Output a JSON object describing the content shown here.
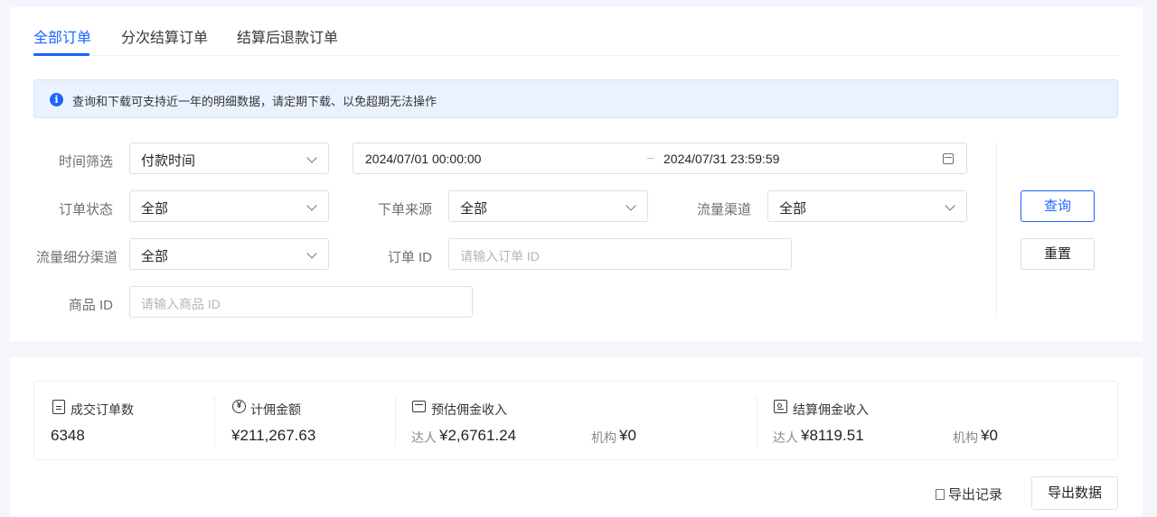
{
  "tabs": [
    {
      "label": "全部订单",
      "active": true
    },
    {
      "label": "分次结算订单",
      "active": false
    },
    {
      "label": "结算后退款订单",
      "active": false
    }
  ],
  "notice": {
    "icon": "info-icon",
    "text": "查询和下载可支持近一年的明细数据，请定期下载、以免超期无法操作"
  },
  "filters": {
    "time_filter": {
      "label": "时间筛选",
      "value": "付款时间"
    },
    "date_range": {
      "start": "2024/07/01 00:00:00",
      "separator": "–",
      "end": "2024/07/31 23:59:59"
    },
    "order_status": {
      "label": "订单状态",
      "value": "全部"
    },
    "order_source": {
      "label": "下单来源",
      "value": "全部"
    },
    "traffic_channel": {
      "label": "流量渠道",
      "value": "全部"
    },
    "traffic_sub_channel": {
      "label": "流量细分渠道",
      "value": "全部"
    },
    "order_id": {
      "label": "订单 ID",
      "placeholder": "请输入订单 ID"
    },
    "product_id": {
      "label": "商品 ID",
      "placeholder": "请输入商品 ID"
    }
  },
  "actions": {
    "query": "查询",
    "reset": "重置"
  },
  "stats": {
    "deal_orders": {
      "title": "成交订单数",
      "value": "6348"
    },
    "commission_amount": {
      "title": "计佣金额",
      "value": "¥211,267.63"
    },
    "estimated_income": {
      "title": "预估佣金收入",
      "talent_label": "达人",
      "talent_value": "¥2,6761.24",
      "agency_label": "机构",
      "agency_value": "¥0"
    },
    "settled_income": {
      "title": "结算佣金收入",
      "talent_label": "达人",
      "talent_value": "¥8119.51",
      "agency_label": "机构",
      "agency_value": "¥0"
    }
  },
  "export": {
    "records": "导出记录",
    "data": "导出数据"
  },
  "colors": {
    "accent": "#1966ff",
    "notice_bg": "#ebf2fe",
    "page_bg": "#f4f6fb"
  }
}
